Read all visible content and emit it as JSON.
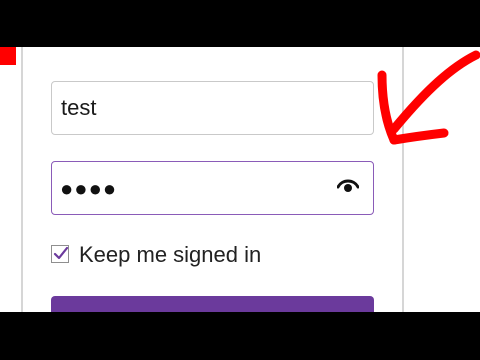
{
  "login_form": {
    "username_value": "test",
    "password_mask": "●●●●",
    "keep_signed_in_label": "Keep me signed in",
    "keep_signed_in_checked": true,
    "show_password_icon": "eye-icon"
  },
  "annotation": {
    "arrow_color": "#ff0000"
  },
  "colors": {
    "accent": "#6b3a9c",
    "focus_border": "#8a5bb8"
  }
}
